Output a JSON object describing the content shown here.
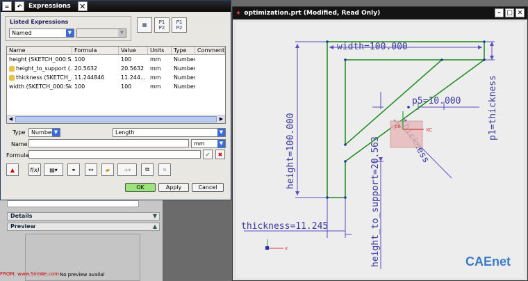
{
  "dialog": {
    "title": "Expressions",
    "listed_label": "Listed Expressions",
    "listed_value": "Named",
    "columns": [
      "Name",
      "Formula",
      "Value",
      "Units",
      "Type",
      "Comment"
    ],
    "rows": [
      {
        "name": "height (SKETCH_000:S...",
        "formula": "100",
        "value": "100",
        "units": "mm",
        "type": "Number",
        "locked": false
      },
      {
        "name": "height_to_support (...",
        "formula": "20.5632",
        "value": "20.5632",
        "units": "mm",
        "type": "Number",
        "locked": true
      },
      {
        "name": "thickness (SKETCH_...",
        "formula": "11.244846",
        "value": "11.244...",
        "units": "mm",
        "type": "Number",
        "locked": true
      },
      {
        "name": "width (SKETCH_000:Sk...",
        "formula": "100",
        "value": "100",
        "units": "mm",
        "type": "Number",
        "locked": false
      }
    ],
    "type_label": "Type",
    "type_value": "Number",
    "dim_value": "Length",
    "name_label": "Name",
    "units_value": "mm",
    "formula_label": "Formula",
    "ok_label": "OK",
    "apply_label": "Apply",
    "cancel_label": "Cancel"
  },
  "left_panel": {
    "details_label": "Details",
    "preview_label": "Preview",
    "no_preview": "No preview availal",
    "watermark": "FROM: www.SimWe.com"
  },
  "cad": {
    "title": "optimization.prt (Modified, Read Only)",
    "dims": {
      "width": "width=100.000",
      "height": "height=100.000",
      "p5": "p5=10.000",
      "p1": "p1=thickness",
      "thickness": "thickness=11.245",
      "height_to_support": "height_to_support=20.563",
      "thickness_diag": "thickness",
      "p6": "p6"
    },
    "axis_xc": "XC",
    "axis_x": "x",
    "axis_y": "y",
    "logo": "CAEnet"
  }
}
